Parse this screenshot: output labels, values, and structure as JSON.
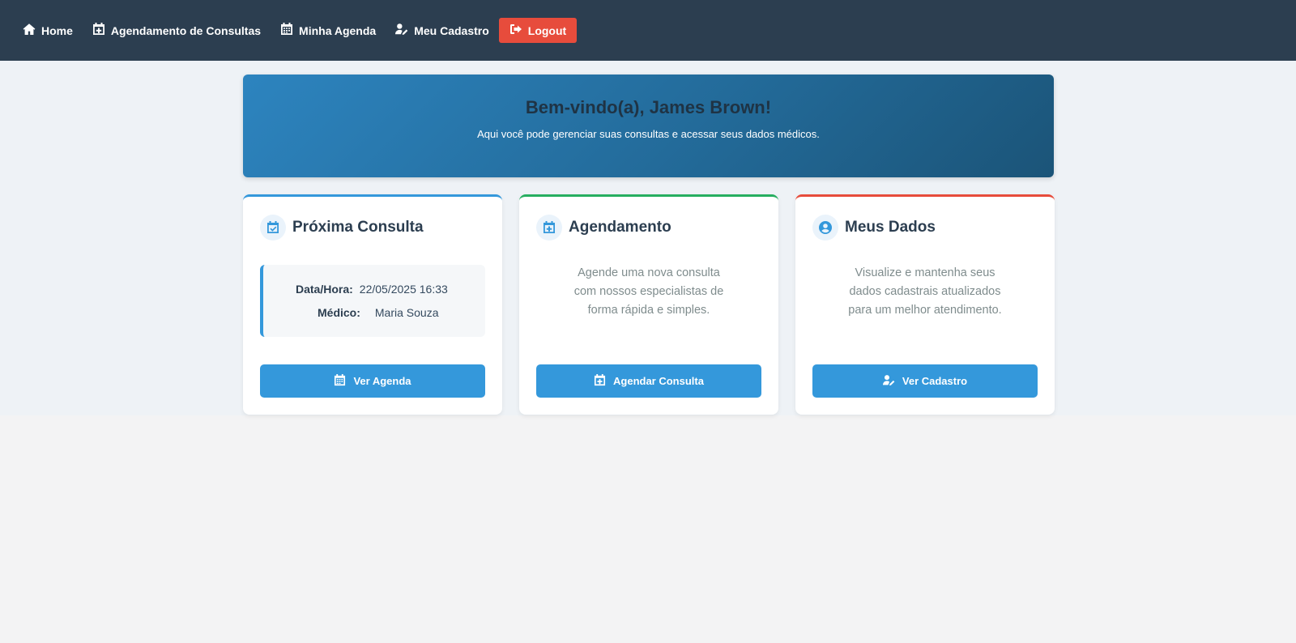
{
  "nav": {
    "home": "Home",
    "agendamento": "Agendamento de Consultas",
    "agenda": "Minha Agenda",
    "cadastro": "Meu Cadastro",
    "logout": "Logout"
  },
  "hero": {
    "title": "Bem-vindo(a), James Brown!",
    "subtitle": "Aqui você pode gerenciar suas consultas e acessar seus dados médicos."
  },
  "cards": [
    {
      "title": "Próxima Consulta",
      "icon": "calendar-check-icon",
      "accent": "#3498db",
      "date_label": "Data/Hora:",
      "date_value": "22/05/2025 16:33",
      "doctor_label": "Médico:",
      "doctor_value": "Maria Souza",
      "button": "Ver Agenda"
    },
    {
      "title": "Agendamento",
      "icon": "calendar-plus-icon",
      "accent": "#27ae60",
      "text_lines": [
        "Agende uma nova consulta",
        "com nossos especialistas de",
        "forma rápida e simples."
      ],
      "button": "Agendar Consulta"
    },
    {
      "title": "Meus Dados",
      "icon": "user-circle-icon",
      "accent": "#e74c3c",
      "text_lines": [
        "Visualize e mantenha seus",
        "dados cadastrais atualizados",
        "para um melhor atendimento."
      ],
      "button": "Ver Cadastro"
    }
  ],
  "colors": {
    "navbar": "#2c3e50",
    "primary": "#3498db",
    "logout": "#e74c3c"
  }
}
